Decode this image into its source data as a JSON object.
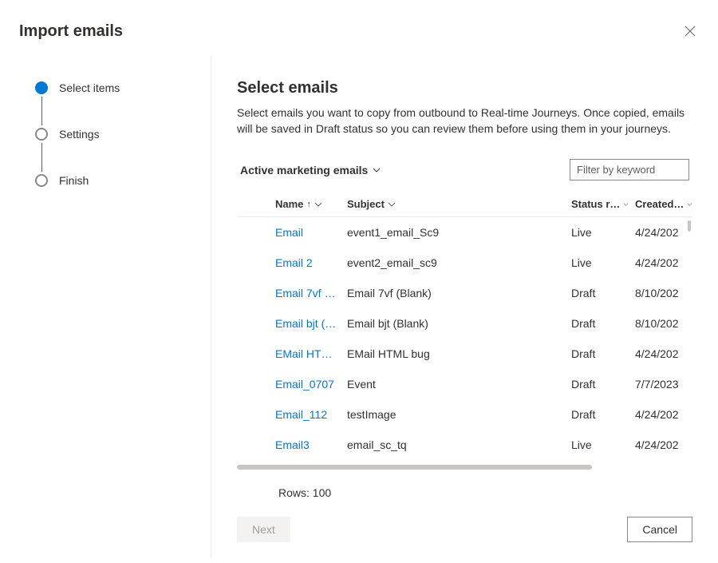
{
  "header": {
    "title": "Import emails"
  },
  "sidebar": {
    "steps": [
      {
        "label": "Select items",
        "state": "active"
      },
      {
        "label": "Settings",
        "state": "inactive"
      },
      {
        "label": "Finish",
        "state": "inactive"
      }
    ]
  },
  "main": {
    "heading": "Select emails",
    "description": "Select emails you want to copy from outbound to Real-time Journeys. Once copied, emails will be saved in Draft status so you can review them before using them in your journeys.",
    "view_selector": "Active marketing emails",
    "filter_placeholder": "Filter by keyword",
    "columns": {
      "name": "Name",
      "subject": "Subject",
      "status": "Status r…",
      "created": "Created…"
    },
    "rows": [
      {
        "name": "Email",
        "subject": "event1_email_Sc9",
        "status": "Live",
        "created": "4/24/202"
      },
      {
        "name": "Email 2",
        "subject": "event2_email_sc9",
        "status": "Live",
        "created": "4/24/202"
      },
      {
        "name": "Email 7vf …",
        "subject": "Email 7vf (Blank)",
        "status": "Draft",
        "created": "8/10/202"
      },
      {
        "name": "Email bjt (…",
        "subject": "Email bjt (Blank)",
        "status": "Draft",
        "created": "8/10/202"
      },
      {
        "name": "EMail HT…",
        "subject": "EMail HTML bug",
        "status": "Draft",
        "created": "4/24/202"
      },
      {
        "name": "Email_0707",
        "subject": "Event",
        "status": "Draft",
        "created": "7/7/2023"
      },
      {
        "name": "Email_112",
        "subject": "testImage",
        "status": "Draft",
        "created": "4/24/202"
      },
      {
        "name": "Email3",
        "subject": "email_sc_tq",
        "status": "Live",
        "created": "4/24/202"
      }
    ],
    "rows_count": "Rows: 100"
  },
  "footer": {
    "next_label": "Next",
    "cancel_label": "Cancel"
  }
}
